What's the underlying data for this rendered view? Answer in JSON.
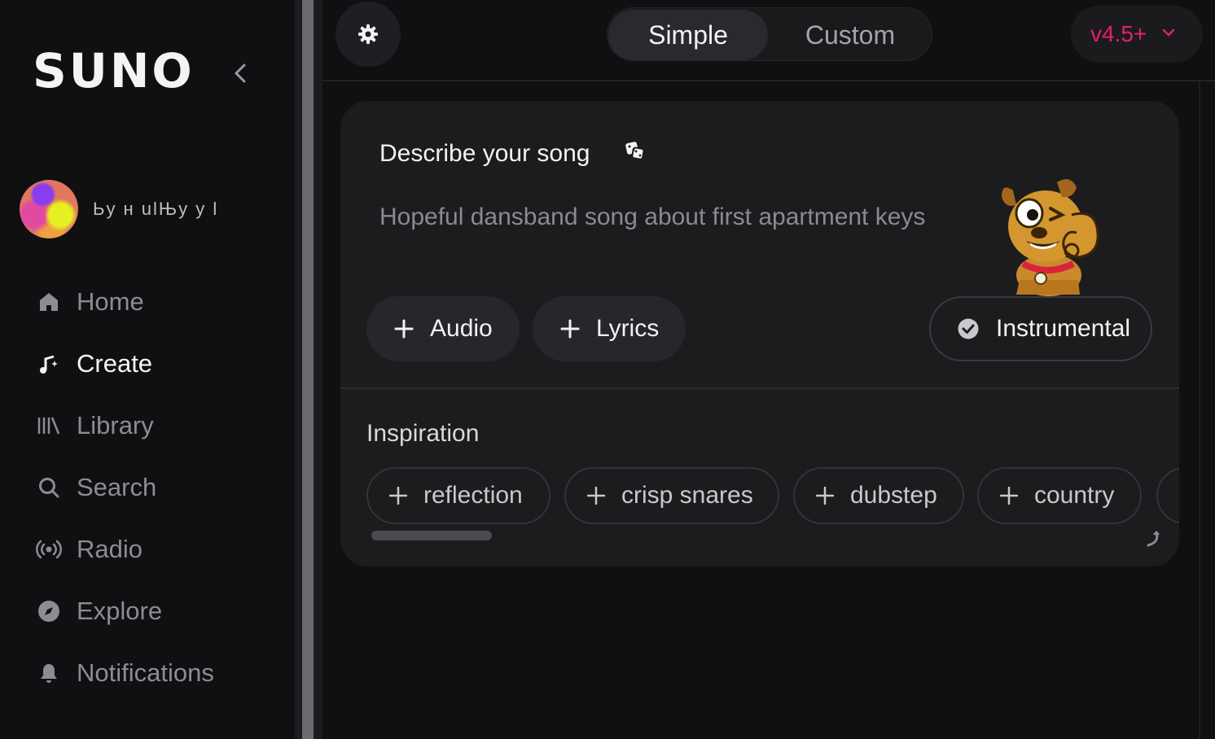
{
  "sidebar": {
    "logo": "SUNO",
    "user": {
      "name": "Ьу н ulЊу у l"
    },
    "items": [
      {
        "label": "Home",
        "icon": "home-icon",
        "active": false
      },
      {
        "label": "Create",
        "icon": "create-music-icon",
        "active": true
      },
      {
        "label": "Library",
        "icon": "library-icon",
        "active": false
      },
      {
        "label": "Search",
        "icon": "search-icon",
        "active": false
      },
      {
        "label": "Radio",
        "icon": "radio-icon",
        "active": false
      },
      {
        "label": "Explore",
        "icon": "compass-icon",
        "active": false
      },
      {
        "label": "Notifications",
        "icon": "bell-icon",
        "active": false
      }
    ]
  },
  "topbar": {
    "mode_options": [
      "Simple",
      "Custom"
    ],
    "selected_mode": "Simple",
    "version": "v4.5+"
  },
  "card": {
    "describe_title": "Describe your song",
    "prompt_value": "Hopeful dansband song about first apartment keys",
    "buttons": {
      "audio": "Audio",
      "lyrics": "Lyrics",
      "instrumental": "Instrumental"
    },
    "instrumental_checked": true,
    "inspiration_title": "Inspiration",
    "inspiration_chips": [
      "reflection",
      "crisp snares",
      "dubstep",
      "country"
    ]
  },
  "colors": {
    "accent": "#e3206a",
    "background": "#101012",
    "card": "#1c1c1f"
  }
}
